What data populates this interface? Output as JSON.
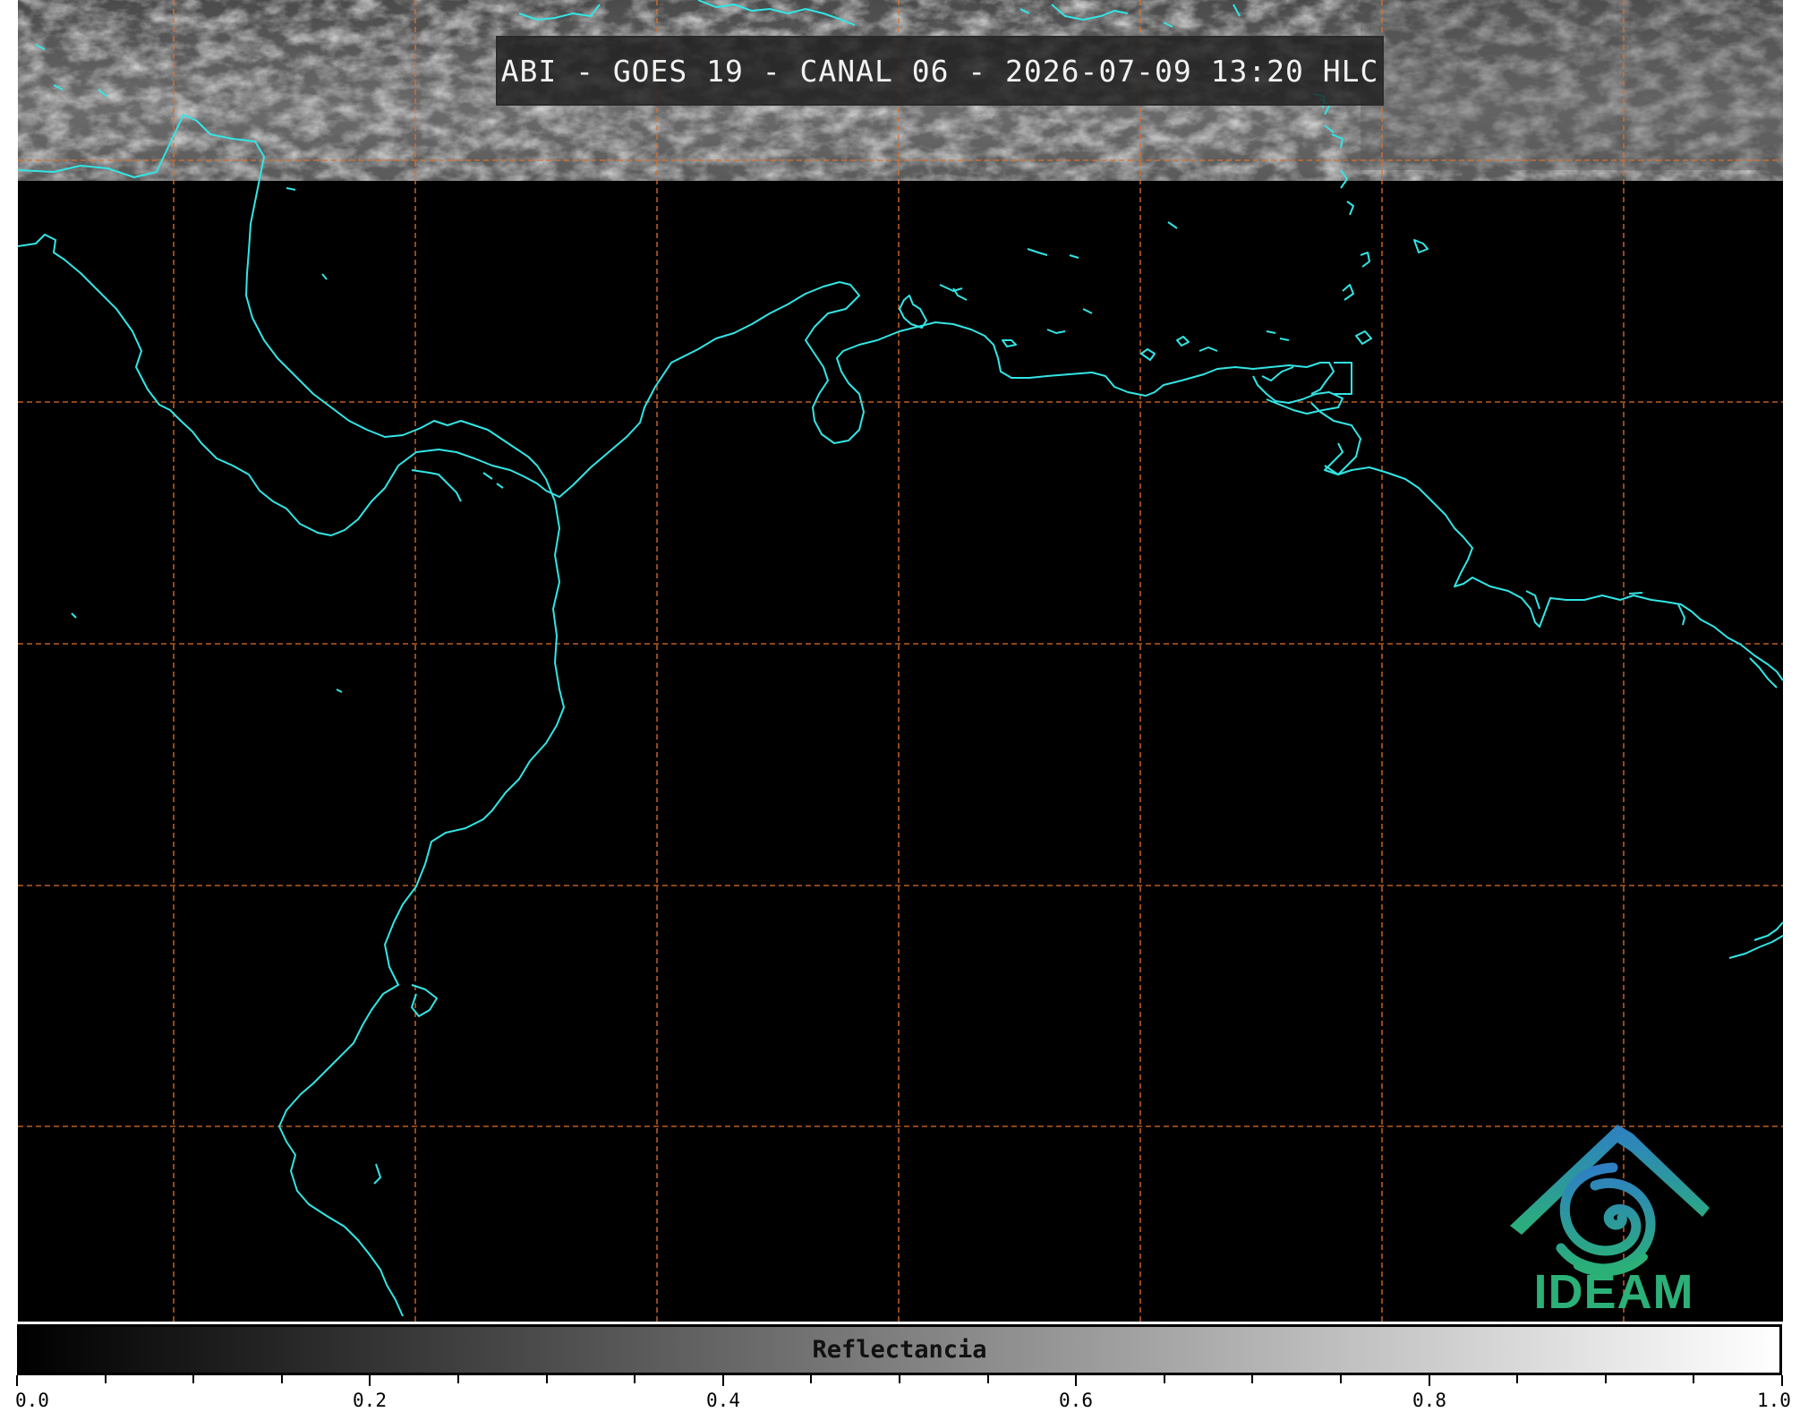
{
  "header": {
    "title": "ABI - GOES 19 - CANAL 06 - 2026-07-09 13:20 HLC"
  },
  "colorbar": {
    "label": "Reflectancia",
    "min": 0.0,
    "max": 1.0,
    "tick_labels": [
      "0.0",
      "0.2",
      "0.4",
      "0.6",
      "0.8",
      "1.0"
    ],
    "colors": {
      "low": "#000000",
      "high": "#ffffff"
    }
  },
  "logo": {
    "text": "IDEAM",
    "icon": "ideam-mountain-spiral-icon",
    "colors": {
      "top": "#2e7fc4",
      "bottom": "#2bb078"
    }
  },
  "map": {
    "coastline_color": "#33e5e5",
    "grid_color": "#e0702a",
    "cloud_band_color": "#7a7a7a"
  }
}
